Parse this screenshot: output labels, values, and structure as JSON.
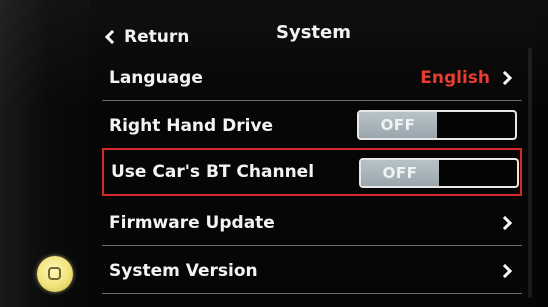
{
  "header": {
    "back_label": "Return",
    "title": "System"
  },
  "rows": [
    {
      "label": "Language",
      "value": "English"
    },
    {
      "label": "Right Hand Drive",
      "toggle": "OFF"
    },
    {
      "label": "Use Car's BT Channel",
      "toggle": "OFF"
    },
    {
      "label": "Firmware Update"
    },
    {
      "label": "System Version"
    }
  ],
  "colors": {
    "accent_value": "#e83a2f",
    "highlight_border": "#d62a2a",
    "home_button": "#f0e37a"
  },
  "icons": {
    "back": "chevron-left-icon",
    "row_arrow": "chevron-right-icon",
    "home": "home-button-icon"
  }
}
